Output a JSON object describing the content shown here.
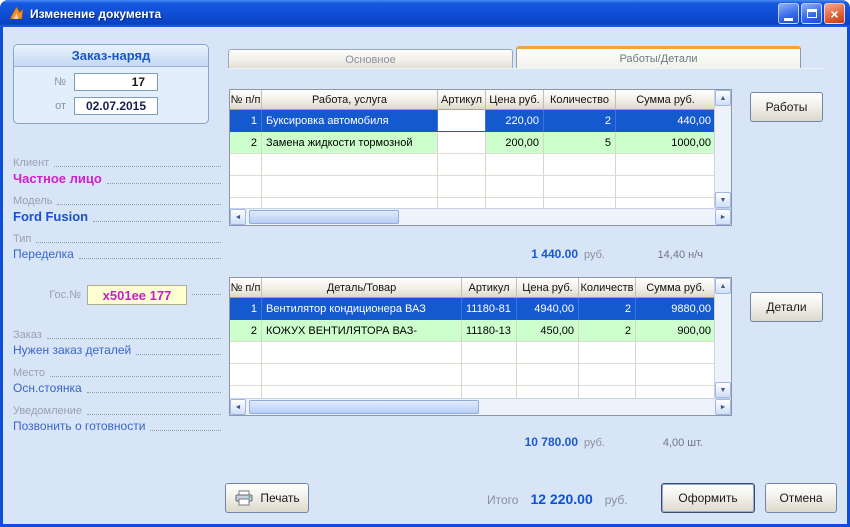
{
  "window": {
    "title": "Изменение документа"
  },
  "icons": {
    "close": "×",
    "arrow_up": "▲",
    "arrow_down": "▼",
    "arrow_left": "◄",
    "arrow_right": "►"
  },
  "colors": {
    "selected_row": "#1459ce",
    "alt_row": "#ccffcc",
    "accent_blue": "#0b52d6",
    "magenta": "#cf1fcf",
    "tab_accent": "#f6a23c",
    "titlebar": "#0f4fd8"
  },
  "sidebar": {
    "order": {
      "title": "Заказ-наряд",
      "number_label": "№",
      "number": "17",
      "date_label": "от",
      "date": "02.07.2015"
    },
    "fields": {
      "client": {
        "label": "Клиент",
        "value": "Частное лицо"
      },
      "model": {
        "label": "Модель",
        "value": "Ford Fusion"
      },
      "type": {
        "label": "Тип",
        "value": "Переделка"
      },
      "gosnum": {
        "label": "Гос.№",
        "value": "x501ee 177"
      },
      "order_status": {
        "label": "Заказ",
        "value": "Нужен заказ деталей"
      },
      "place": {
        "label": "Место",
        "value": "Осн.стоянка"
      },
      "notify": {
        "label": "Уведомление",
        "value": "Позвонить о готовности"
      }
    }
  },
  "tabs": {
    "main": "Основное",
    "details": "Работы/Детали"
  },
  "works_table": {
    "headers": [
      "№ п/п",
      "Работа, услуга",
      "Артикул",
      "Цена руб.",
      "Количество",
      "Сумма руб."
    ],
    "rows": [
      {
        "num": "1",
        "name": "Буксировка автомобиля",
        "art": "",
        "price": "220,00",
        "qty": "2",
        "sum": "440,00"
      },
      {
        "num": "2",
        "name": "Замена жидкости тормозной",
        "art": "",
        "price": "200,00",
        "qty": "5",
        "sum": "1000,00"
      }
    ],
    "total": "1 440.00",
    "total_currency": "руб.",
    "hours": "14,40 н/ч",
    "button": "Работы"
  },
  "parts_table": {
    "headers": [
      "№ п/п",
      "Деталь/Товар",
      "Артикул",
      "Цена руб.",
      "Количеств",
      "Сумма руб."
    ],
    "rows": [
      {
        "num": "1",
        "name": "Вентилятор кондиционера ВАЗ",
        "art": "11180-81",
        "price": "4940,00",
        "qty": "2",
        "sum": "9880,00"
      },
      {
        "num": "2",
        "name": "КОЖУХ ВЕНТИЛЯТОРА ВАЗ-",
        "art": "11180-13",
        "price": "450,00",
        "qty": "2",
        "sum": "900,00"
      }
    ],
    "total": "10 780.00",
    "total_currency": "руб.",
    "units": "4,00 шт.",
    "button": "Детали"
  },
  "footer": {
    "print": "Печать",
    "total_label": "Итого",
    "total_value": "12 220.00",
    "currency": "руб.",
    "submit": "Оформить",
    "cancel": "Отмена"
  }
}
